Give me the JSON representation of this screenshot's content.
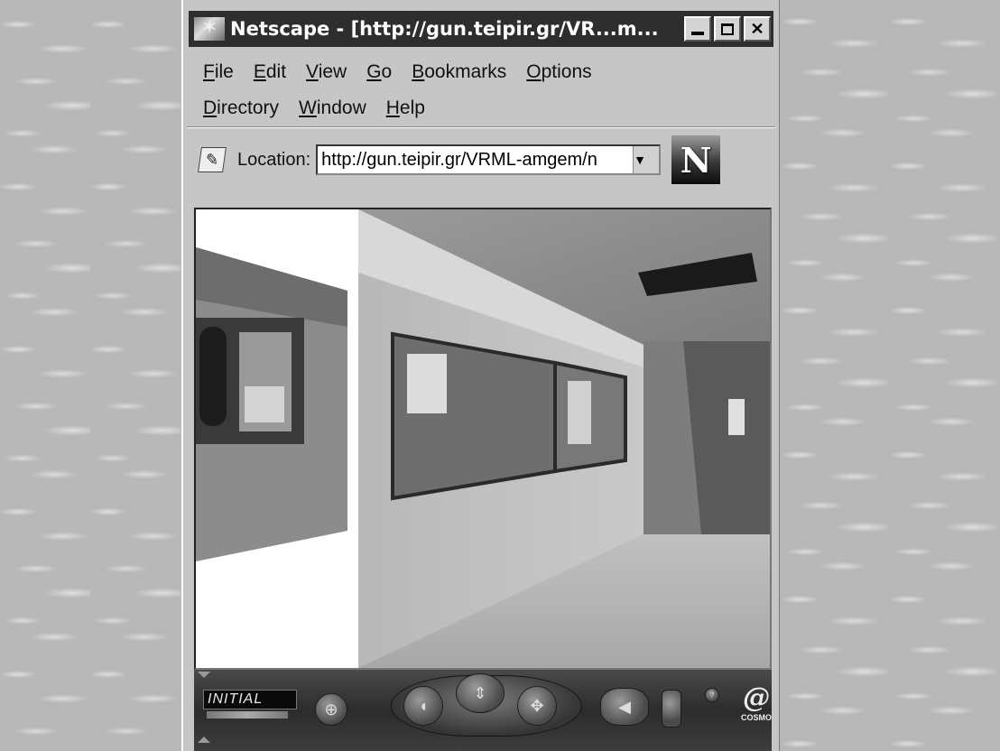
{
  "window": {
    "title": "Netscape - [http://gun.teipir.gr/VR...m...",
    "minimize_label": "",
    "maximize_label": "",
    "close_label": "✕"
  },
  "menu": {
    "row1": [
      {
        "u": "F",
        "rest": "ile"
      },
      {
        "u": "E",
        "rest": "dit"
      },
      {
        "u": "V",
        "rest": "iew"
      },
      {
        "u": "G",
        "rest": "o"
      },
      {
        "u": "B",
        "rest": "ookmarks"
      },
      {
        "u": "O",
        "rest": "ptions"
      }
    ],
    "row2": [
      {
        "u": "D",
        "rest": "irectory"
      },
      {
        "u": "W",
        "rest": "indow"
      },
      {
        "u": "H",
        "rest": "elp"
      }
    ]
  },
  "location": {
    "label": "Location:",
    "url": "http://gun.teipir.gr/VRML-amgem/n",
    "dropdown_arrow": "▼",
    "logo_letter": "N"
  },
  "cosmo": {
    "viewpoint": "INITIAL",
    "logo_text": "COSMO",
    "logo_glyph": "@"
  },
  "icons": {
    "location_bookmark": "bookmark-icon",
    "app": "netscape-icon"
  },
  "colors": {
    "titlebar": "#2e2e2e",
    "chrome": "#c6c6c6",
    "desktop": "#b8b8b8",
    "cosmo_bar": "#3a3a3a"
  }
}
